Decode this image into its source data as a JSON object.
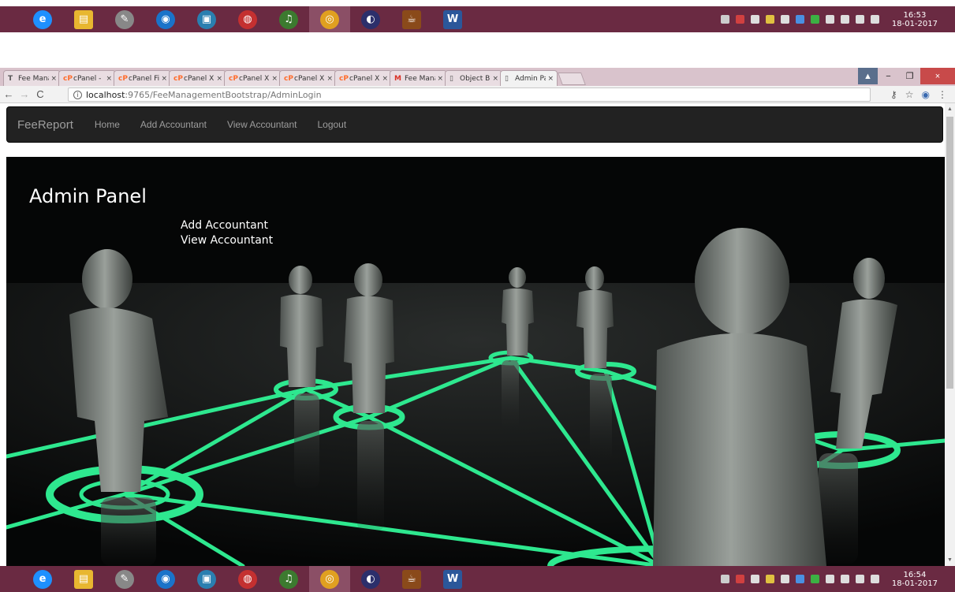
{
  "taskbar_top": {
    "apps": [
      {
        "name": "internet-explorer-icon",
        "glyph": "e",
        "color": "#1e90ff",
        "active": false
      },
      {
        "name": "file-explorer-icon",
        "glyph": "▤",
        "color": "#e8b730",
        "active": false
      },
      {
        "name": "scanner-app-icon",
        "glyph": "✎",
        "color": "#888888",
        "active": false
      },
      {
        "name": "disc-app-icon",
        "glyph": "◉",
        "color": "#1a73c9",
        "active": false
      },
      {
        "name": "film-app-icon",
        "glyph": "▣",
        "color": "#2a7fb0",
        "active": false
      },
      {
        "name": "audio-app-icon",
        "glyph": "◍",
        "color": "#c43030",
        "active": false
      },
      {
        "name": "itunes-icon",
        "glyph": "♫",
        "color": "#3c7a2f",
        "active": false
      },
      {
        "name": "chrome-icon",
        "glyph": "◎",
        "color": "#e0a020",
        "active": true
      },
      {
        "name": "eclipse-icon",
        "glyph": "◐",
        "color": "#2c2f6b",
        "active": false
      },
      {
        "name": "java-ide-icon",
        "glyph": "☕",
        "color": "#8a4a1a",
        "active": false
      },
      {
        "name": "word-icon",
        "glyph": "W",
        "color": "#2b579a",
        "active": false
      }
    ],
    "clock_time": "16:53",
    "clock_date": "18-01-2017"
  },
  "taskbar_bottom": {
    "clock_time": "16:54",
    "clock_date": "18-01-2017"
  },
  "tray_colors": [
    "#cccccc",
    "#d04040",
    "#dddddd",
    "#e0c040",
    "#dddddd",
    "#4a90e2",
    "#3cb043",
    "#dddddd",
    "#dddddd",
    "#dddddd",
    "#dddddd"
  ],
  "browser": {
    "tabs": [
      {
        "favicon": "T",
        "label": "Fee Manag",
        "favicon_color": "#555555",
        "active": false
      },
      {
        "favicon": "cP",
        "label": "cPanel - N",
        "favicon_color": "#ff6c2c",
        "active": false
      },
      {
        "favicon": "cP",
        "label": "cPanel File",
        "favicon_color": "#ff6c2c",
        "active": false
      },
      {
        "favicon": "cP",
        "label": "cPanel X -",
        "favicon_color": "#ff6c2c",
        "active": false
      },
      {
        "favicon": "cP",
        "label": "cPanel X",
        "favicon_color": "#ff6c2c",
        "active": false
      },
      {
        "favicon": "cP",
        "label": "cPanel X -",
        "favicon_color": "#ff6c2c",
        "active": false
      },
      {
        "favicon": "cP",
        "label": "cPanel X -",
        "favicon_color": "#ff6c2c",
        "active": false
      },
      {
        "favicon": "M",
        "label": "Fee Mana",
        "favicon_color": "#d93025",
        "active": false
      },
      {
        "favicon": "▯",
        "label": "Object Bro",
        "favicon_color": "#555555",
        "active": false
      },
      {
        "favicon": "▯",
        "label": "Admin Pa",
        "favicon_color": "#555555",
        "active": true
      }
    ],
    "tab_close_glyph": "×",
    "url_host": "localhost",
    "url_path": ":9765/FeeManagementBootstrap/AdminLogin",
    "info_glyph": "i",
    "back_glyph": "←",
    "forward_glyph": "→",
    "reload_glyph": "C",
    "key_glyph": "⚷",
    "star_glyph": "☆",
    "profile_glyph": "◉",
    "menu_glyph": "⋮",
    "win_user_glyph": "▲",
    "win_min_glyph": "−",
    "win_max_glyph": "❐",
    "win_close_glyph": "×"
  },
  "page": {
    "navbar": {
      "brand": "FeeReport",
      "links": [
        "Home",
        "Add Accountant",
        "View Accountant",
        "Logout"
      ]
    },
    "hero": {
      "title": "Admin Panel",
      "links": [
        "Add Accountant",
        "View Accountant"
      ]
    }
  }
}
